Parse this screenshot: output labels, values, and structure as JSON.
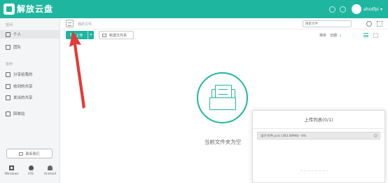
{
  "app": {
    "name": "解放云盘"
  },
  "topbar": {
    "username": "ahsdfpi",
    "dropdown_caret": "▾"
  },
  "sidebar": {
    "section1_title": "空间",
    "section2_title": "协作",
    "items": [
      {
        "label": "个人",
        "icon": "user-icon"
      },
      {
        "label": "团队",
        "icon": "team-icon"
      },
      {
        "label": "分享给我的",
        "icon": "share-icon"
      },
      {
        "label": "收到的共享",
        "icon": "inbox-icon"
      },
      {
        "label": "发出的共享",
        "icon": "outbox-icon"
      },
      {
        "label": "回收站",
        "icon": "trash-icon"
      }
    ],
    "feedback_label": "联系我们",
    "platforms": [
      {
        "label": "Windows",
        "icon": "windows-icon"
      },
      {
        "label": "iOS",
        "icon": "apple-icon"
      },
      {
        "label": "Android",
        "icon": "android-icon"
      }
    ]
  },
  "main": {
    "breadcrumb": "我的文件",
    "search_placeholder": "搜索文件",
    "toolbar": {
      "upload_label": "上传",
      "upload_icon": "↥",
      "upload_caret": "▾",
      "new_folder_label": "新建文件夹",
      "sort_label": "排序",
      "sort_date": "日期",
      "sort_arrow": "↓"
    },
    "empty_text": "当前文件夹为空"
  },
  "upload_panel": {
    "title": "上传列表(0/1)",
    "item_text": "设计文件.psd (383.89MB) -0%",
    "progress_fraction": 0.0
  },
  "colors": {
    "accent": "#1fb6a0",
    "annotation": "#e53935"
  }
}
